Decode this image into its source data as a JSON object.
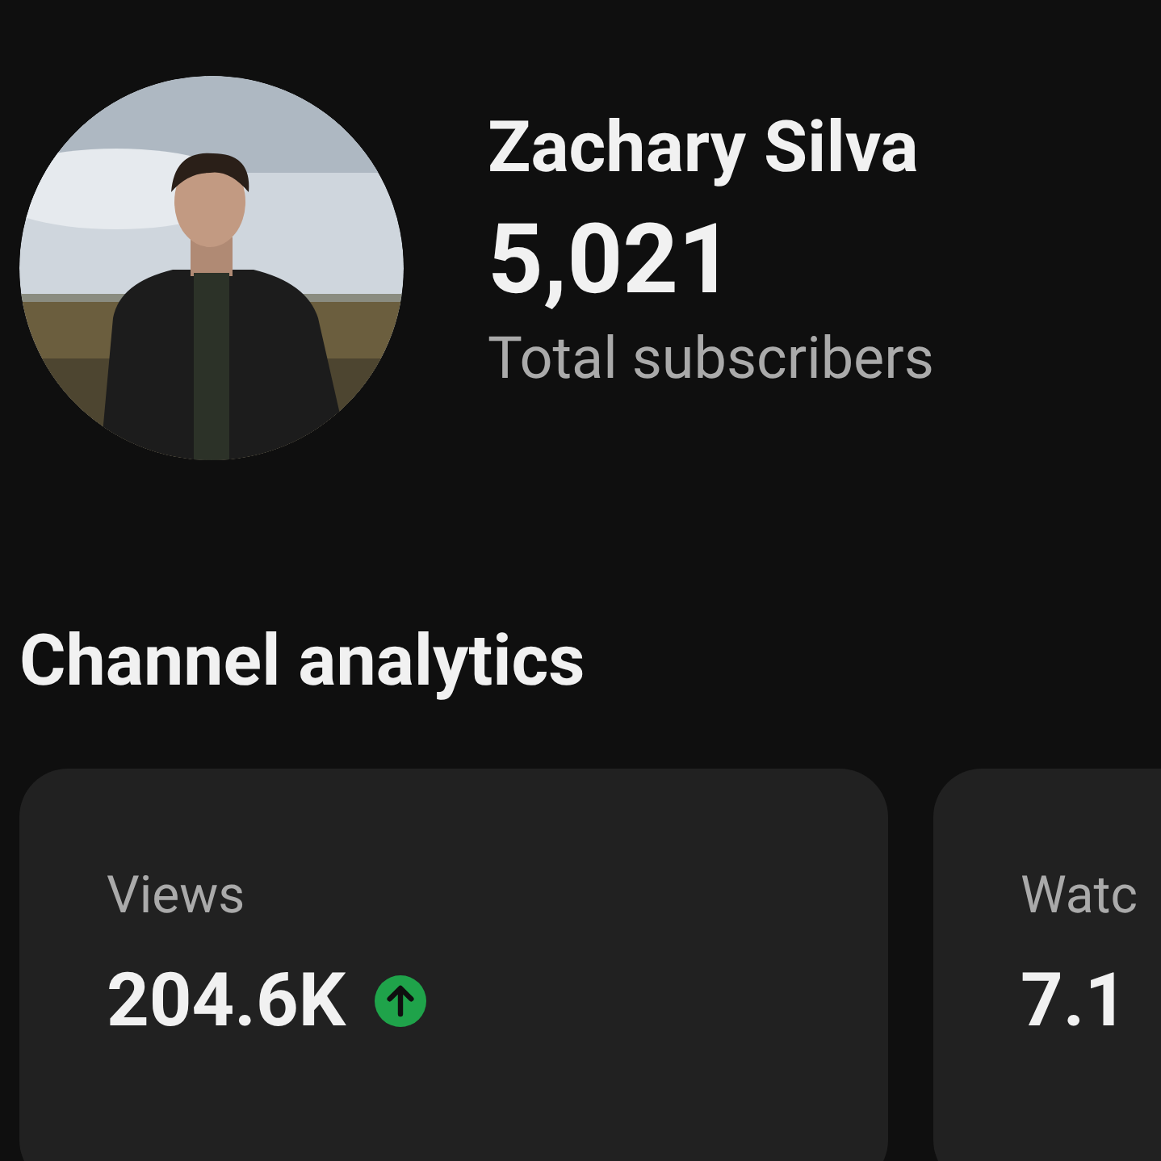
{
  "profile": {
    "name": "Zachary Silva",
    "subscriber_count": "5,021",
    "subscriber_label": "Total subscribers"
  },
  "section_title": "Channel analytics",
  "cards": [
    {
      "label": "Views",
      "value": "204.6K",
      "trending_up": true
    },
    {
      "label": "Watc",
      "value": "7.1"
    }
  ]
}
